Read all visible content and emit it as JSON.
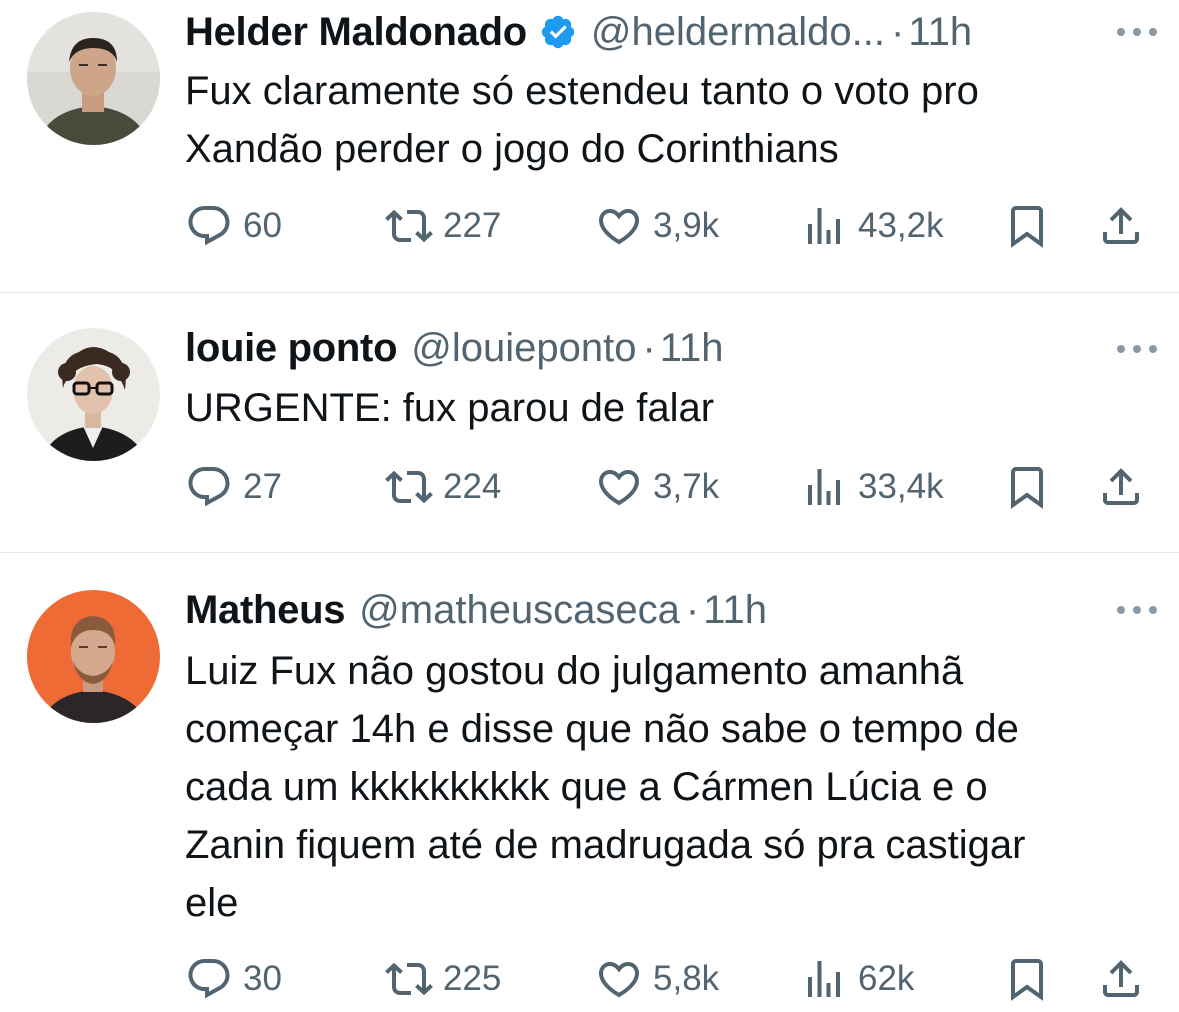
{
  "tweets": [
    {
      "name": "Helder Maldonado",
      "verified": true,
      "handle": "@heldermaldo...",
      "separator": "·",
      "time": "11h",
      "lines": [
        "Fux claramente só estendeu tanto o voto pro",
        "Xandão perder o jogo do Corinthians"
      ],
      "replies": "60",
      "retweets": "227",
      "likes": "3,9k",
      "views": "43,2k"
    },
    {
      "name": "louie ponto",
      "verified": false,
      "handle": "@louieponto",
      "separator": "·",
      "time": "11h",
      "lines": [
        "URGENTE: fux parou de falar"
      ],
      "replies": "27",
      "retweets": "224",
      "likes": "3,7k",
      "views": "33,4k"
    },
    {
      "name": "Matheus",
      "verified": false,
      "handle": "@matheuscaseca",
      "separator": "·",
      "time": "11h",
      "lines": [
        "Luiz Fux não gostou do julgamento amanhã",
        "começar 14h e disse que não sabe o tempo de",
        "cada um kkkkkkkkkk que a Cármen Lúcia e o",
        "Zanin fiquem até de madrugada só pra castigar",
        "ele"
      ],
      "replies": "30",
      "retweets": "225",
      "likes": "5,8k",
      "views": "62k"
    }
  ],
  "icons": {
    "reply": "reply-icon",
    "retweet": "retweet-icon",
    "like": "heart-icon",
    "views": "views-icon",
    "bookmark": "bookmark-icon",
    "share": "share-icon",
    "verified": "verified-badge-icon",
    "more": "more-options-icon"
  },
  "colors": {
    "text": "#0f1419",
    "muted": "#536471",
    "verified": "#1d9bf0",
    "divider": "#e4e8eb"
  }
}
